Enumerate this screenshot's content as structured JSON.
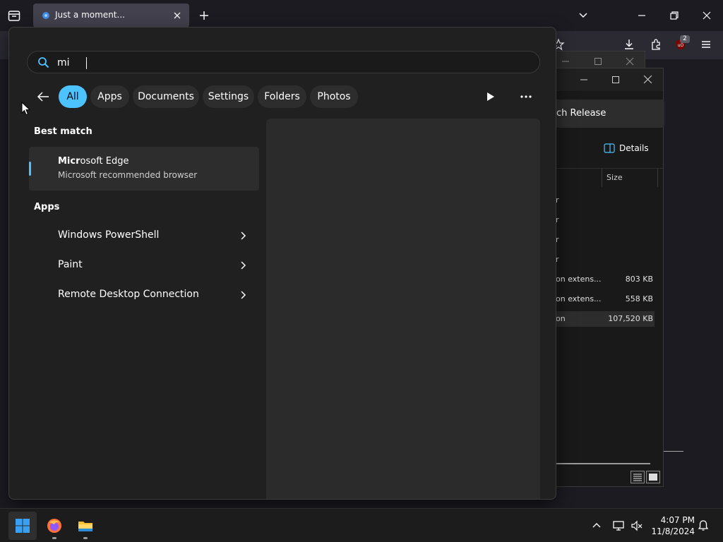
{
  "browser": {
    "tab_title": "Just a moment...",
    "extension_badge": "2"
  },
  "explorer": {
    "address_text": "ch Release",
    "details_label": "Details",
    "size_header": "Size",
    "rows": [
      {
        "type": "r",
        "size": ""
      },
      {
        "type": "r",
        "size": ""
      },
      {
        "type": "r",
        "size": ""
      },
      {
        "type": "r",
        "size": ""
      },
      {
        "type": "on extens...",
        "size": "803 KB"
      },
      {
        "type": "on extens...",
        "size": "558 KB"
      },
      {
        "type": "on",
        "size": "107,520 KB"
      }
    ]
  },
  "search": {
    "query": "mi",
    "filters": [
      {
        "label": "All",
        "active": true
      },
      {
        "label": "Apps",
        "active": false
      },
      {
        "label": "Documents",
        "active": false
      },
      {
        "label": "Settings",
        "active": false
      },
      {
        "label": "Folders",
        "active": false
      },
      {
        "label": "Photos",
        "active": false
      }
    ],
    "best_match_title": "Best match",
    "best_match": {
      "name_bold": "Micr",
      "name_rest": "osoft Edge",
      "subtitle": "Microsoft recommended browser"
    },
    "apps_title": "Apps",
    "apps": [
      {
        "label": "Windows PowerShell",
        "icon": "powershell-icon"
      },
      {
        "label": "Paint",
        "icon": "paint-icon"
      },
      {
        "label": "Remote Desktop Connection",
        "icon": "remote-desktop-icon"
      }
    ]
  },
  "taskbar": {
    "time": "4:07 PM",
    "date": "11/8/2024"
  },
  "colors": {
    "accent": "#4cc2ff",
    "panel": "#202020",
    "preview": "#2b2b2b",
    "taskbar": "#1c1c1c"
  }
}
